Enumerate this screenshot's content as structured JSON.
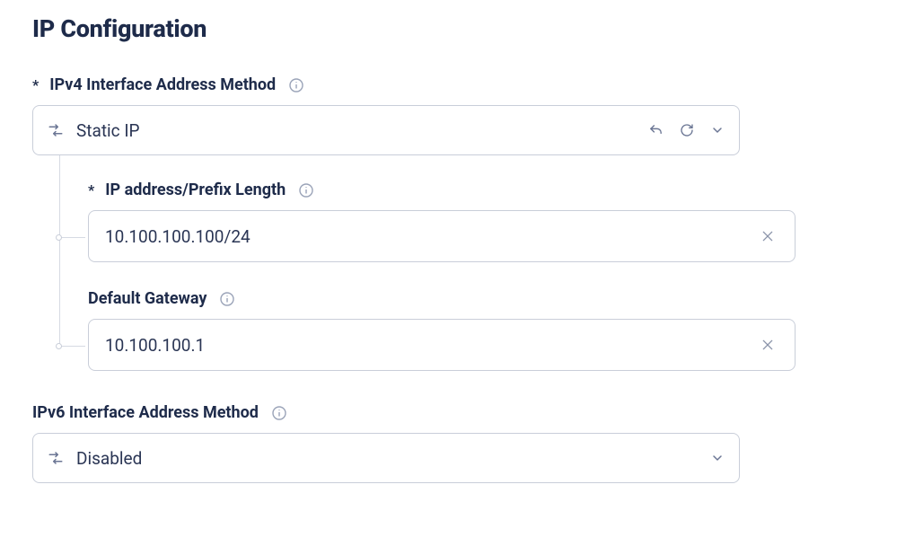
{
  "title": "IP Configuration",
  "ipv4": {
    "method_label": "IPv4 Interface Address Method",
    "method_value": "Static IP",
    "required": "*",
    "ip_prefix": {
      "label": "IP address/Prefix Length",
      "required": "*",
      "value": "10.100.100.100/24"
    },
    "gateway": {
      "label": "Default Gateway",
      "value": "10.100.100.1"
    }
  },
  "ipv6": {
    "method_label": "IPv6 Interface Address Method",
    "method_value": "Disabled"
  }
}
